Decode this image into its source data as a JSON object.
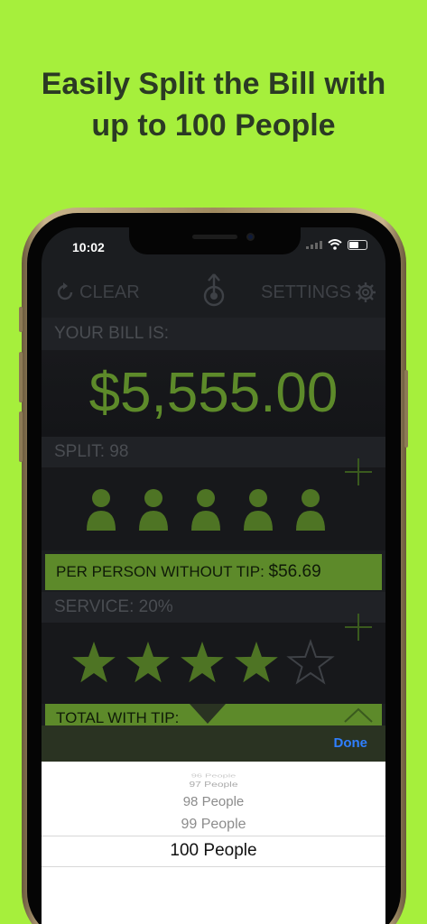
{
  "headline": {
    "line1": "Easily Split the Bill with",
    "line2": "up to 100 People"
  },
  "status": {
    "time": "10:02"
  },
  "toolbar": {
    "clear_label": "CLEAR",
    "settings_label": "SETTINGS"
  },
  "bill": {
    "label": "YOUR BILL IS:",
    "amount": "$5,555.00"
  },
  "split": {
    "label": "SPLIT: 98"
  },
  "per_person": {
    "label": "PER PERSON WITHOUT TIP:",
    "value": "$56.69"
  },
  "service": {
    "label": "SERVICE: 20%",
    "rating_filled": 4,
    "rating_max": 5
  },
  "total": {
    "label": "TOTAL WITH TIP:"
  },
  "picker_bar": {
    "done_label": "Done"
  },
  "picker": {
    "options": [
      "96 People",
      "97 People",
      "98 People",
      "99 People",
      "100 People"
    ],
    "selected": "100 People"
  },
  "colors": {
    "accent": "#5d8a2a",
    "background": "#a6ef3c",
    "done": "#2f7fff"
  }
}
